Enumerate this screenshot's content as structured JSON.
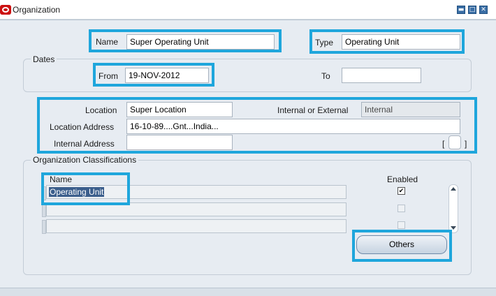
{
  "window": {
    "title": "Organization",
    "minimize_glyph": "▬",
    "maximize_glyph": "□",
    "close_glyph": "✕"
  },
  "header": {
    "name_label": "Name",
    "name_value": "Super Operating Unit",
    "type_label": "Type",
    "type_value": "Operating Unit"
  },
  "dates": {
    "group_label": "Dates",
    "from_label": "From",
    "from_value": "19-NOV-2012",
    "to_label": "To",
    "to_value": ""
  },
  "location": {
    "location_label": "Location",
    "location_value": "Super Location",
    "int_ext_label": "Internal or External",
    "int_ext_value": "Internal",
    "address_label": "Location Address",
    "address_value": "16-10-89....Gnt...India...",
    "internal_address_label": "Internal Address",
    "internal_address_value": "",
    "bracket_open": "[",
    "bracket_close": "]"
  },
  "classifications": {
    "group_label": "Organization Classifications",
    "name_header": "Name",
    "enabled_header": "Enabled",
    "rows": [
      {
        "name": "Operating Unit",
        "enabled": true
      },
      {
        "name": "",
        "enabled": false
      },
      {
        "name": "",
        "enabled": false
      }
    ],
    "others_button": "Others",
    "check_glyph": "✔"
  },
  "colors": {
    "highlight": "#1fa6dc",
    "form_bg": "#e7ecf2",
    "brand": "#cc1111"
  }
}
